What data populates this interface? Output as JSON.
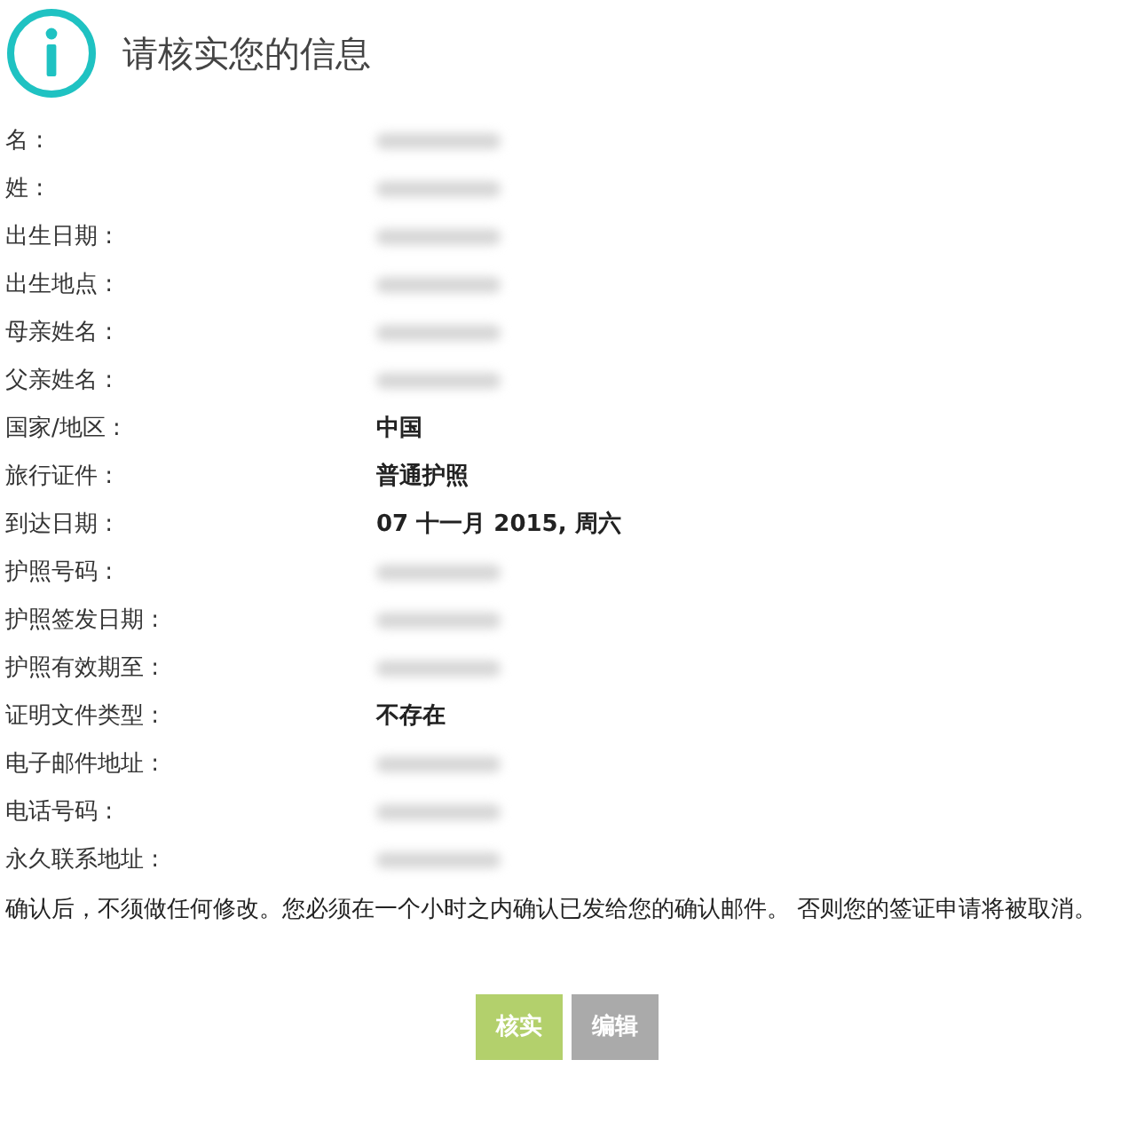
{
  "header": {
    "title": "请核实您的信息"
  },
  "fields": [
    {
      "label": "名 :",
      "kind": "redacted"
    },
    {
      "label": "姓 :",
      "kind": "redacted"
    },
    {
      "label": "出生日期 :",
      "kind": "redacted"
    },
    {
      "label": "出生地点 :",
      "kind": "redacted"
    },
    {
      "label": "母亲姓名 :",
      "kind": "redacted"
    },
    {
      "label": "父亲姓名 :",
      "kind": "redacted"
    },
    {
      "label": "国家/地区 :",
      "kind": "text",
      "value": "中国"
    },
    {
      "label": "旅行证件 :",
      "kind": "text",
      "value": "普通护照"
    },
    {
      "label": "到达日期 :",
      "kind": "text",
      "value": "07 十一月 2015, 周六"
    },
    {
      "label": "护照号码 :",
      "kind": "redacted"
    },
    {
      "label": "护照签发日期 :",
      "kind": "redacted"
    },
    {
      "label": "护照有效期至 :",
      "kind": "redacted"
    },
    {
      "label": "证明文件类型 :",
      "kind": "text",
      "value": "不存在"
    },
    {
      "label": "电子邮件地址 :",
      "kind": "redacted"
    },
    {
      "label": "电话号码 :",
      "kind": "redacted"
    },
    {
      "label": "永久联系地址 :",
      "kind": "redacted"
    }
  ],
  "notice": "确认后，不须做任何修改。您必须在一个小时之内确认已发给您的确认邮件。 否则您的签证申请将被取消。",
  "buttons": [
    {
      "label": "核实",
      "kind": "primary"
    },
    {
      "label": "编辑",
      "kind": "secondary"
    }
  ]
}
